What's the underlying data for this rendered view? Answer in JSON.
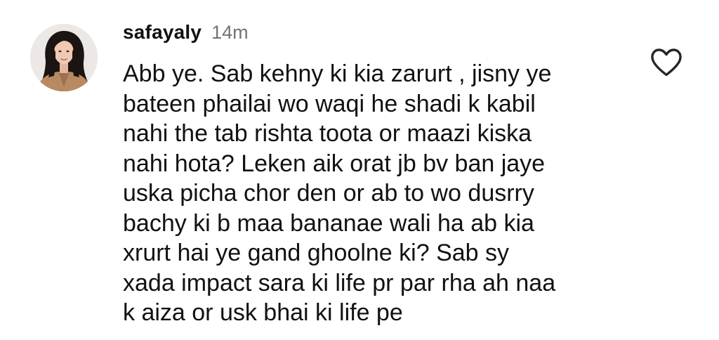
{
  "comment": {
    "username": "safayaly",
    "timestamp": "14m",
    "avatar_icon": "profile-photo",
    "like_icon": "heart-outline-icon",
    "text_lines": [
      "Abb ye. Sab kehny ki kia zarurt , jisny ye",
      "bateen phailai wo waqi he shadi k kabil",
      "nahi the tab rishta toota or maazi kiska",
      "nahi hota? Leken aik orat jb bv ban jaye",
      "uska picha chor den or ab to wo dusrry",
      "bachy ki b maa bananae wali ha ab kia",
      "xrurt hai ye gand ghoolne ki? Sab sy",
      "xada impact sara ki life pr par rha ah naa",
      "k aiza or usk bhai ki life pe"
    ]
  },
  "colors": {
    "text": "#111111",
    "timestamp": "#737373",
    "background": "#ffffff",
    "icon": "#262626"
  }
}
